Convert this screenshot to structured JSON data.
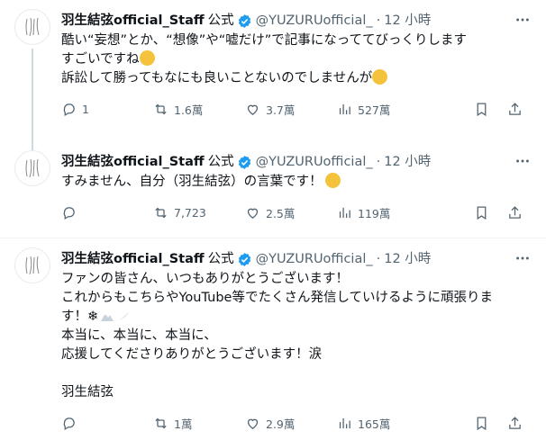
{
  "author": {
    "name": "羽生結弦official_Staff",
    "official": "公式",
    "handle": "@YUZURUofficial_",
    "sep": "·"
  },
  "tweets": [
    {
      "time": "12 小時",
      "lines": [
        "酷い“妄想”とか、“想像”や“嘘だけ”で記事になっててびっくりします",
        "すごいですね",
        "訴訟して勝ってもなにも良いことないのでしませんが"
      ],
      "reply_count": "1",
      "retweet_count": "1.6萬",
      "like_count": "3.7萬",
      "view_count": "527萬"
    },
    {
      "time": "12 小時",
      "lines": [
        "すみません、自分（羽生結弦）の言葉です！"
      ],
      "reply_count": "",
      "retweet_count": "7,723",
      "like_count": "2.5萬",
      "view_count": "119萬"
    },
    {
      "time": "12 小時",
      "lines": [
        "ファンの皆さん、いつもありがとうございます！",
        "これからもこちらやYouTube等でたくさん発信していけるように頑張りま",
        "す！❄",
        "本当に、本当に、本当に、",
        "応援してくださりありがとうございます！涙",
        "",
        "羽生結弦"
      ],
      "reply_count": "",
      "retweet_count": "1萬",
      "like_count": "2.9萬",
      "view_count": "165萬"
    }
  ],
  "colors": {
    "text": "#0f1419",
    "muted": "#536471",
    "verified": "#1d9bf0",
    "line": "#cfd9de"
  }
}
